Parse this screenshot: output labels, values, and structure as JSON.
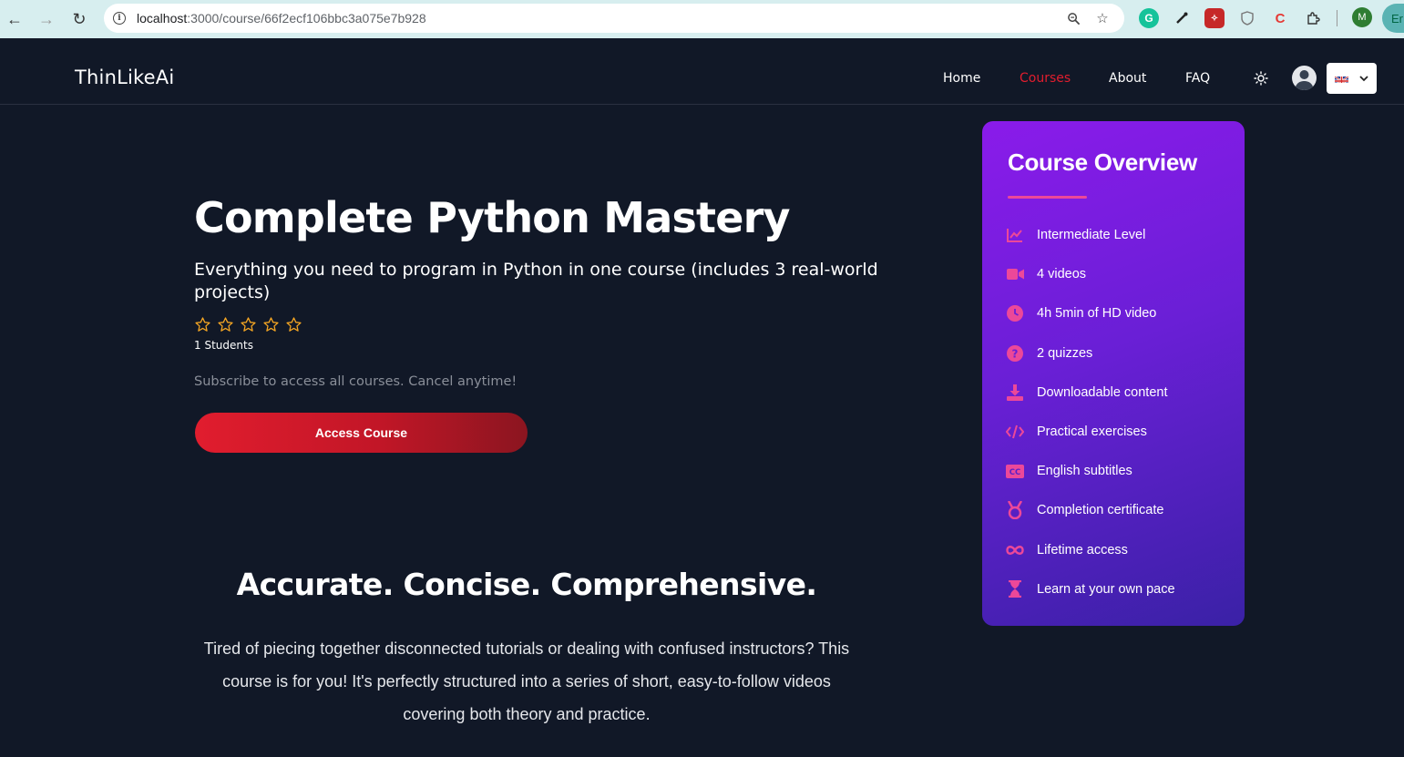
{
  "browser": {
    "url_host": "localhost",
    "url_path": ":3000/course/66f2ecf106bbc3a075e7b928",
    "profile_initial": "M",
    "edge_label": "Er"
  },
  "header": {
    "logo": "ThinLikeAi",
    "nav": [
      {
        "label": "Home",
        "active": false
      },
      {
        "label": "Courses",
        "active": true
      },
      {
        "label": "About",
        "active": false
      },
      {
        "label": "FAQ",
        "active": false
      }
    ],
    "accent_color": "#e11d2e"
  },
  "course": {
    "title": "Complete Python Mastery",
    "subtitle": "Everything you need to program in Python in one course (includes 3 real-world projects)",
    "rating_stars": 5,
    "rating_filled": 0,
    "students": "1 Students",
    "subscribe_note": "Subscribe to access all courses. Cancel anytime!",
    "cta_label": "Access Course"
  },
  "section": {
    "title": "Accurate. Concise. Comprehensive.",
    "body": "Tired of piecing together disconnected tutorials or dealing with confused instructors? This course is for you! It's perfectly structured into a series of short, easy-to-follow videos covering both theory and practice."
  },
  "overview": {
    "title": "Course Overview",
    "icon_color": "#ec4899",
    "items": [
      {
        "icon": "chart-line-icon",
        "label": "Intermediate Level"
      },
      {
        "icon": "video-camera-icon",
        "label": "4 videos"
      },
      {
        "icon": "clock-icon",
        "label": "4h 5min of HD video"
      },
      {
        "icon": "question-circle-icon",
        "label": "2 quizzes"
      },
      {
        "icon": "download-icon",
        "label": "Downloadable content"
      },
      {
        "icon": "code-icon",
        "label": "Practical exercises"
      },
      {
        "icon": "closed-caption-icon",
        "label": "English subtitles"
      },
      {
        "icon": "medal-icon",
        "label": "Completion certificate"
      },
      {
        "icon": "infinity-icon",
        "label": "Lifetime access"
      },
      {
        "icon": "hourglass-icon",
        "label": "Learn at your own pace"
      }
    ]
  }
}
